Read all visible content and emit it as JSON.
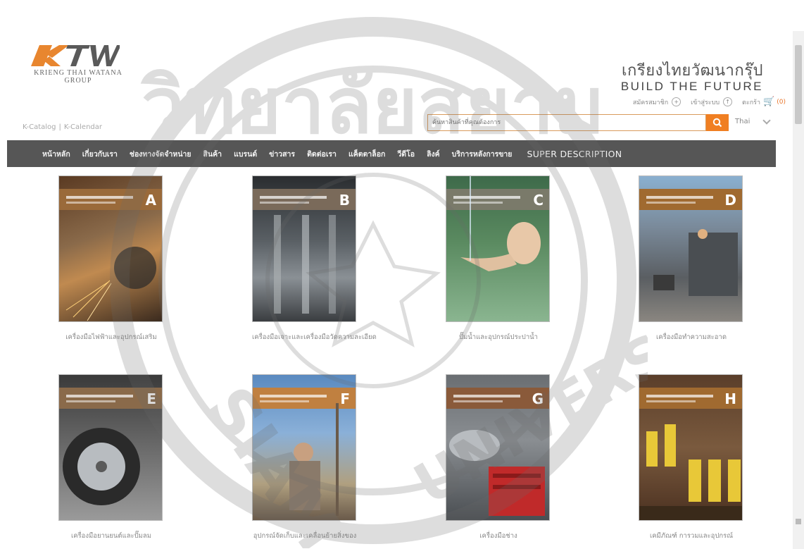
{
  "header": {
    "logo_mark": "KTW",
    "logo_line1": "KRIENG THAI WATANA",
    "logo_line2": "GROUP",
    "brand_th": "เกรียงไทยวัฒนากรุ๊ป",
    "brand_en": "BUILD THE FUTURE",
    "register_label": "สมัครสมาชิก",
    "login_label": "เข้าสู่ระบบ",
    "cart_label": "ตะกร้า",
    "cart_count": "(0)",
    "kcatalog_1": "K-Catalog",
    "kcatalog_2": "K-Calendar",
    "search_placeholder": "ค้นหาสินค้าที่คุณต้องการ",
    "language": "Thai"
  },
  "nav": {
    "items": [
      "หน้าหลัก",
      "เกี่ยวกับเรา",
      "ช่องทางจัดจำหน่าย",
      "สินค้า",
      "แบรนด์",
      "ข่าวสาร",
      "ติดต่อเรา",
      "แค็ตตาล็อก",
      "วีดีโอ",
      "ลิงค์",
      "บริการหลังการขาย"
    ],
    "super": "SUPER DESCRIPTION"
  },
  "catalogs": [
    {
      "letter": "A",
      "caption": "เครื่องมือไฟฟ้าและอุปกรณ์เสริม"
    },
    {
      "letter": "B",
      "caption": "เครื่องมือเจาะและเครื่องมือวัดความละเอียด"
    },
    {
      "letter": "C",
      "caption": "ปั๊มน้ำและอุปกรณ์ประปาน้ำ"
    },
    {
      "letter": "D",
      "caption": "เครื่องมือทำความสะอาด"
    },
    {
      "letter": "E",
      "caption": "เครื่องมือยานยนต์และปั๊มลม"
    },
    {
      "letter": "F",
      "caption": "อุปกรณ์จัดเก็บและเคลื่อนย้ายสิ่งของ"
    },
    {
      "letter": "G",
      "caption": "เครื่องมือช่าง"
    },
    {
      "letter": "H",
      "caption": "เคมีภัณฑ์ การวมและอุปกรณ์"
    }
  ],
  "watermark": {
    "top_text": "วิทยาลัยสยาม",
    "side_text": "SIAM",
    "bottom_text": "UNIVERSITY"
  },
  "colors": {
    "accent": "#f07f22",
    "nav_bg": "#565656"
  }
}
